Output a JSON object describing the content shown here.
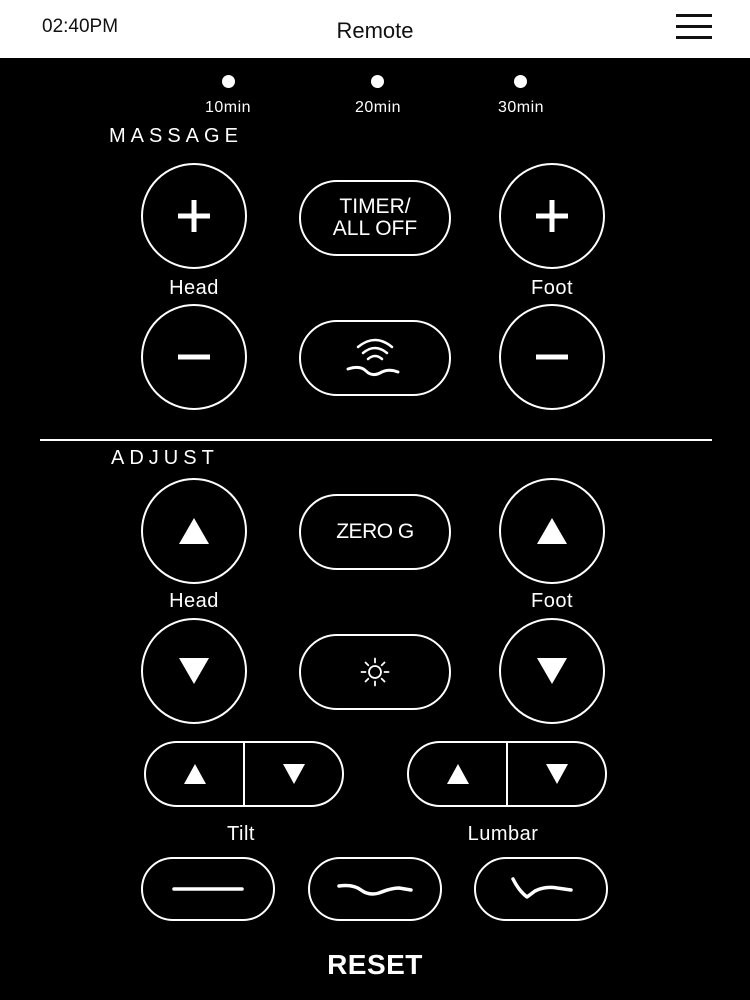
{
  "status_bar": {
    "time": "02:40PM",
    "title": "Remote"
  },
  "timer": {
    "options": [
      "10min",
      "20min",
      "30min"
    ]
  },
  "massage": {
    "section_label": "MASSAGE",
    "head_label": "Head",
    "foot_label": "Foot",
    "timer_button": {
      "line1": "TIMER/",
      "line2": "ALL OFF"
    }
  },
  "adjust": {
    "section_label": "ADJUST",
    "head_label": "Head",
    "foot_label": "Foot",
    "zero_g_label": "ZERO G",
    "tilt_label": "Tilt",
    "lumbar_label": "Lumbar"
  },
  "reset_label": "RESET",
  "icons": {
    "menu": "hamburger-icon",
    "plus": "plus-icon",
    "minus": "minus-icon",
    "up": "triangle-up-icon",
    "down": "triangle-down-icon",
    "wave_massage": "wave-massage-icon",
    "light": "sun-icon",
    "flat": "flat-position-icon",
    "lounge": "lounge-position-icon",
    "tv": "tv-position-icon"
  },
  "colors": {
    "background": "#000000",
    "foreground": "#ffffff",
    "header": "#ffffff"
  }
}
